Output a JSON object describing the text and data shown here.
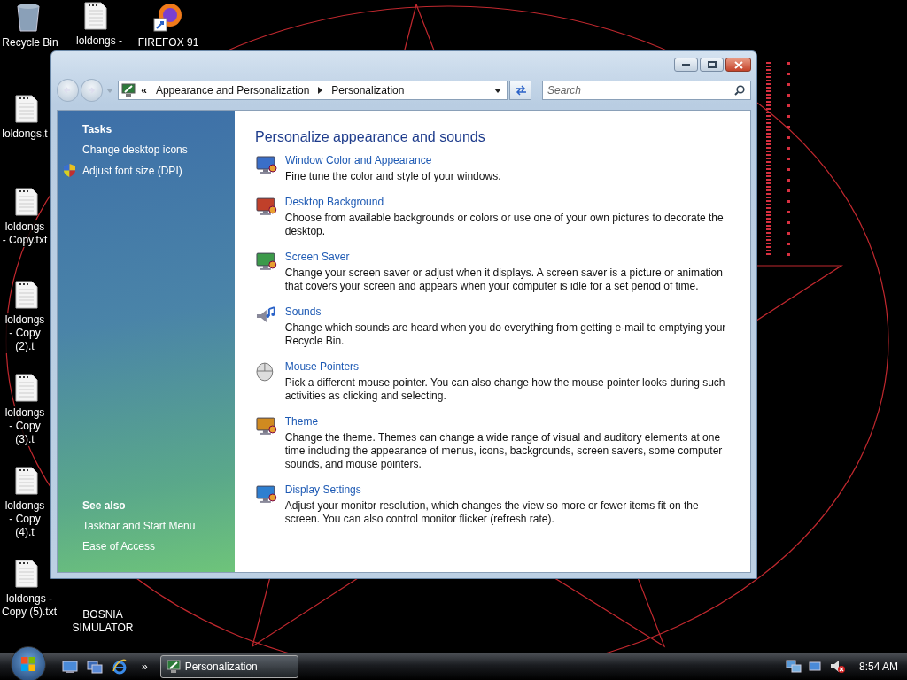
{
  "desktop_icons": [
    {
      "label": "Recycle Bin",
      "kind": "bin"
    },
    {
      "label": "loldongs -",
      "kind": "document"
    },
    {
      "label": "FIREFOX 91",
      "kind": "browser"
    },
    {
      "label": "loldongs.t",
      "kind": "document"
    },
    {
      "label": "loldongs - Copy.txt",
      "kind": "document"
    },
    {
      "label": "loldongs - Copy (2).t",
      "kind": "document"
    },
    {
      "label": "loldongs - Copy (3).t",
      "kind": "document"
    },
    {
      "label": "loldongs - Copy (4).t",
      "kind": "document"
    },
    {
      "label": "loldongs - Copy (5).txt",
      "kind": "document"
    },
    {
      "label": "BOSNIA SIMULATOR",
      "kind": "hidden"
    }
  ],
  "window": {
    "address": {
      "overflow": "«",
      "crumbs": [
        "Appearance and Personalization",
        "Personalization"
      ]
    },
    "search": {
      "placeholder": "Search"
    },
    "sidebar": {
      "tasks_heading": "Tasks",
      "tasks": [
        {
          "label": "Change desktop icons",
          "shield": false
        },
        {
          "label": "Adjust font size (DPI)",
          "shield": true
        }
      ],
      "see_also_heading": "See also",
      "see_also": [
        "Taskbar and Start Menu",
        "Ease of Access"
      ]
    },
    "content": {
      "heading": "Personalize appearance and sounds",
      "items": [
        {
          "kind": "color",
          "title": "Window Color and Appearance",
          "description": "Fine tune the color and style of your windows."
        },
        {
          "kind": "background",
          "title": "Desktop Background",
          "description": "Choose from available backgrounds or colors or use one of your own pictures to decorate the desktop."
        },
        {
          "kind": "screensaver",
          "title": "Screen Saver",
          "description": "Change your screen saver or adjust when it displays. A screen saver is a picture or animation that covers your screen and appears when your computer is idle for a set period of time."
        },
        {
          "kind": "sounds",
          "title": "Sounds",
          "description": "Change which sounds are heard when you do everything from getting e-mail to emptying your Recycle Bin."
        },
        {
          "kind": "mouse",
          "title": "Mouse Pointers",
          "description": "Pick a different mouse pointer. You can also change how the mouse pointer looks during such activities as clicking and selecting."
        },
        {
          "kind": "theme",
          "title": "Theme",
          "description": "Change the theme. Themes can change a wide range of visual and auditory elements at one time including the appearance of menus, icons, backgrounds, screen savers, some computer sounds, and mouse pointers."
        },
        {
          "kind": "display",
          "title": "Display Settings",
          "description": "Adjust your monitor resolution, which changes the view so more or fewer items fit on the screen. You can also control monitor flicker (refresh rate)."
        }
      ]
    }
  },
  "taskbar": {
    "more": "»",
    "tasks": [
      {
        "label": "Personalization",
        "selected": true
      }
    ],
    "clock": "8:54 AM"
  }
}
